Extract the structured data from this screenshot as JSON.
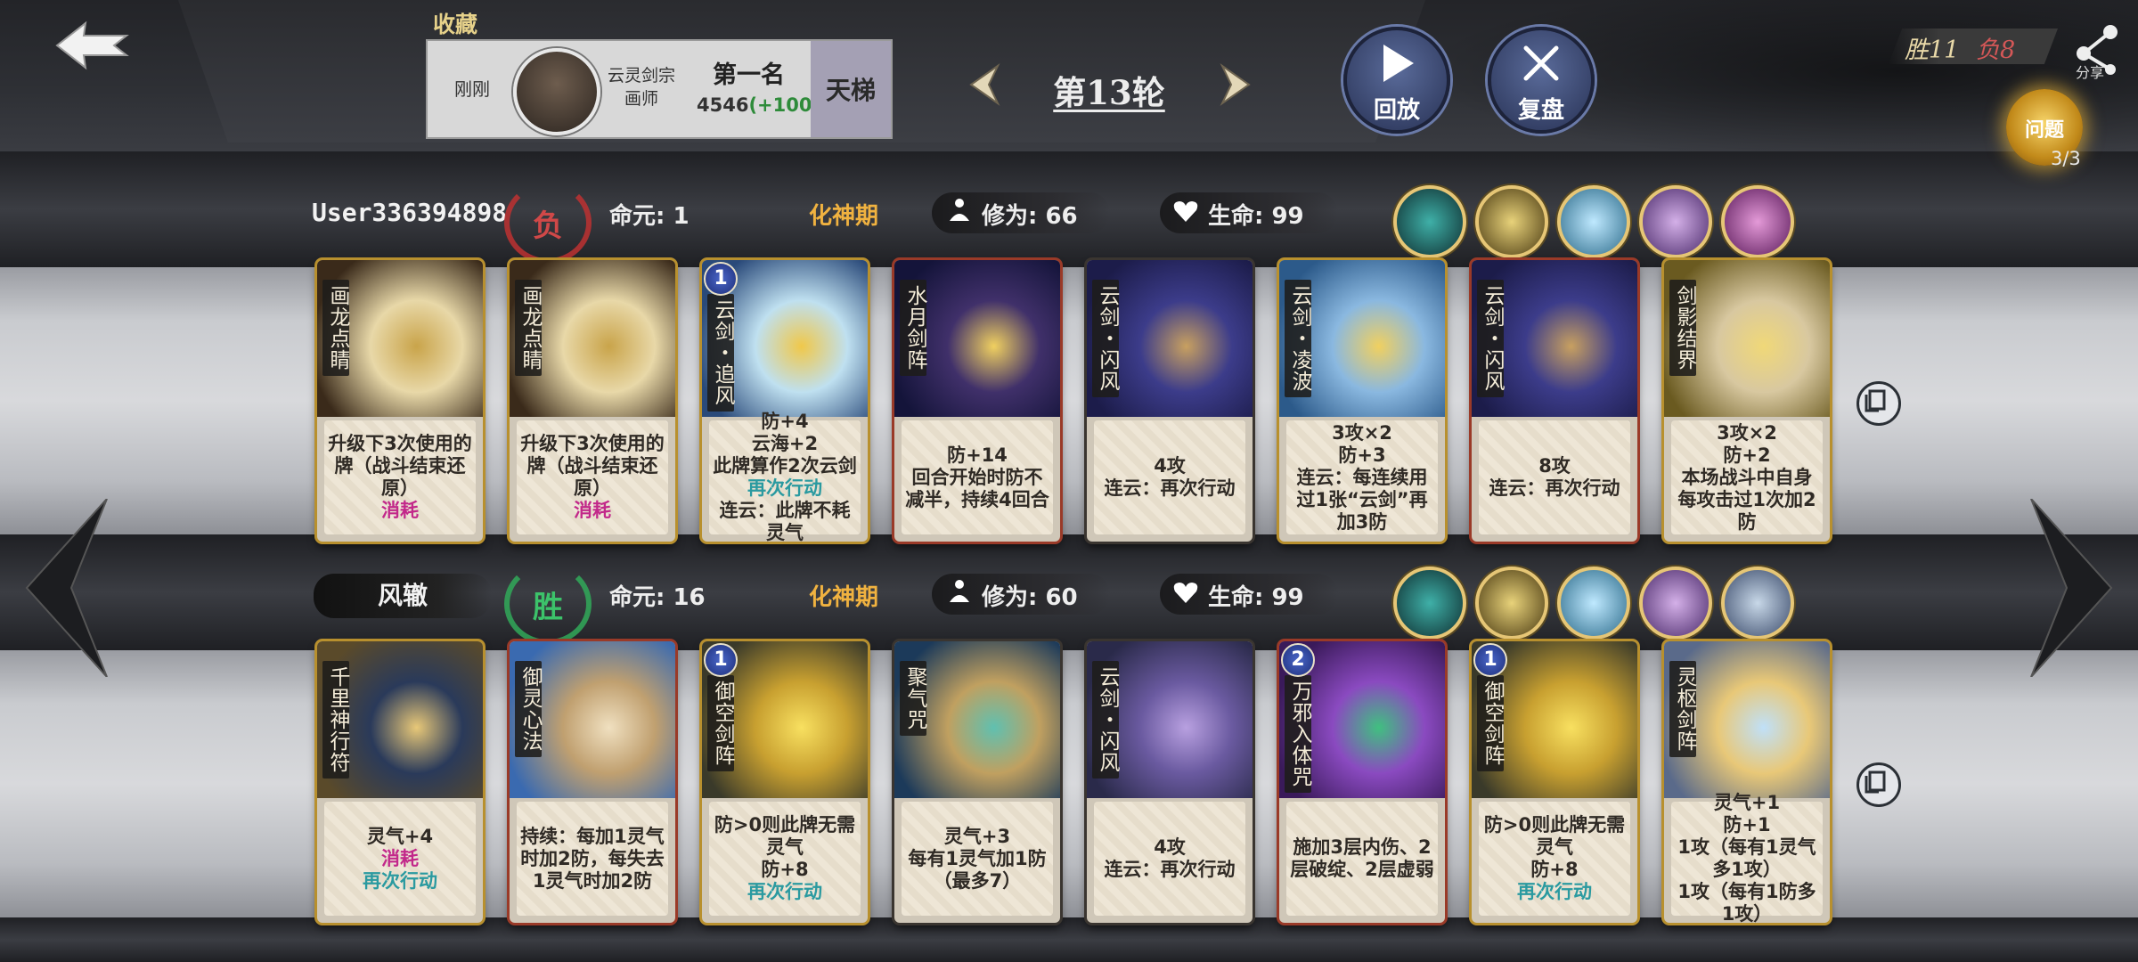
{
  "header": {
    "fav_label": "收藏",
    "player": {
      "time": "刚刚",
      "sect_line1": "云灵剑宗",
      "sect_line2": "画师",
      "rank": "第一名",
      "score": "4546",
      "score_delta": "(+100)",
      "mode": "天梯"
    },
    "round": "第13轮",
    "replay_label": "回放",
    "review_label": "复盘",
    "wins": "胜11",
    "losses": "负8",
    "share_label": "分享",
    "question_label": "问题",
    "question_count": "3/3"
  },
  "opponent": {
    "name": "User336394898",
    "result": "负",
    "mingyuan": "命元: 1",
    "realm": "化神期",
    "xiuwei": "修为: 66",
    "life": "生命: 99",
    "cards": [
      {
        "title": "画龙点睛",
        "level": "",
        "segments": [
          {
            "t": "升级下3次使用的牌（战斗结束还原）",
            "c": ""
          },
          {
            "t": "消耗",
            "c": "pink"
          }
        ]
      },
      {
        "title": "画龙点睛",
        "level": "",
        "segments": [
          {
            "t": "升级下3次使用的牌（战斗结束还原）",
            "c": ""
          },
          {
            "t": "消耗",
            "c": "pink"
          }
        ]
      },
      {
        "title": "云剑・追风",
        "level": "1",
        "segments": [
          {
            "t": "防+4",
            "c": ""
          },
          {
            "t": "云海+2",
            "c": ""
          },
          {
            "t": "此牌算作2次云剑",
            "c": ""
          },
          {
            "t": "再次行动",
            "c": "teal"
          },
          {
            "t": "连云：此牌不耗灵气",
            "c": ""
          }
        ]
      },
      {
        "title": "水月剑阵",
        "level": "",
        "segments": [
          {
            "t": "防+14",
            "c": ""
          },
          {
            "t": "回合开始时防不减半，持续4回合",
            "c": ""
          }
        ]
      },
      {
        "title": "云剑・闪风",
        "level": "",
        "segments": [
          {
            "t": "4攻",
            "c": ""
          },
          {
            "t": "连云：再次行动",
            "c": ""
          }
        ]
      },
      {
        "title": "云剑・凌波",
        "level": "",
        "segments": [
          {
            "t": "3攻×2",
            "c": ""
          },
          {
            "t": "防+3",
            "c": ""
          },
          {
            "t": "连云：每连续用过1张“云剑”再加3防",
            "c": ""
          }
        ]
      },
      {
        "title": "云剑・闪风",
        "level": "",
        "segments": [
          {
            "t": "8攻",
            "c": ""
          },
          {
            "t": "连云：再次行动",
            "c": ""
          }
        ]
      },
      {
        "title": "剑影结界",
        "level": "",
        "segments": [
          {
            "t": "3攻×2",
            "c": ""
          },
          {
            "t": "防+2",
            "c": ""
          },
          {
            "t": "本场战斗中自身每攻击过1次加2防",
            "c": ""
          }
        ]
      }
    ]
  },
  "self": {
    "name": "风辙",
    "result": "胜",
    "mingyuan": "命元: 16",
    "realm": "化神期",
    "xiuwei": "修为: 60",
    "life": "生命: 99",
    "cards": [
      {
        "title": "千里神行符",
        "level": "",
        "segments": [
          {
            "t": "灵气+4",
            "c": ""
          },
          {
            "t": "消耗",
            "c": "pink"
          },
          {
            "t": "再次行动",
            "c": "teal"
          }
        ]
      },
      {
        "title": "御灵心法",
        "level": "",
        "segments": [
          {
            "t": "持续：每加1灵气时加2防，每失去1灵气时加2防",
            "c": ""
          }
        ]
      },
      {
        "title": "御空剑阵",
        "level": "1",
        "segments": [
          {
            "t": "防>0则此牌无需灵气",
            "c": ""
          },
          {
            "t": "防+8",
            "c": ""
          },
          {
            "t": "再次行动",
            "c": "teal"
          }
        ]
      },
      {
        "title": "聚气咒",
        "level": "",
        "segments": [
          {
            "t": "灵气+3",
            "c": ""
          },
          {
            "t": "每有1灵气加1防（最多7）",
            "c": ""
          }
        ]
      },
      {
        "title": "云剑・闪风",
        "level": "",
        "segments": [
          {
            "t": "4攻",
            "c": ""
          },
          {
            "t": "连云：再次行动",
            "c": ""
          }
        ]
      },
      {
        "title": "万邪入体咒",
        "level": "2",
        "segments": [
          {
            "t": "施加3层内伤、2层破绽、2层虚弱",
            "c": ""
          }
        ]
      },
      {
        "title": "御空剑阵",
        "level": "1",
        "segments": [
          {
            "t": "防>0则此牌无需灵气",
            "c": ""
          },
          {
            "t": "防+8",
            "c": ""
          },
          {
            "t": "再次行动",
            "c": "teal"
          }
        ]
      },
      {
        "title": "灵枢剑阵",
        "level": "",
        "segments": [
          {
            "t": "灵气+1",
            "c": ""
          },
          {
            "t": "防+1",
            "c": ""
          },
          {
            "t": "1攻（每有1灵气多1攻）",
            "c": ""
          },
          {
            "t": "1攻（每有1防多1攻）",
            "c": ""
          }
        ]
      }
    ]
  },
  "colors": {
    "realm": "#f0b240",
    "lose": "#d04848",
    "win": "#3cc26a",
    "consume": "#c2288a",
    "action": "#2a9aa0"
  }
}
